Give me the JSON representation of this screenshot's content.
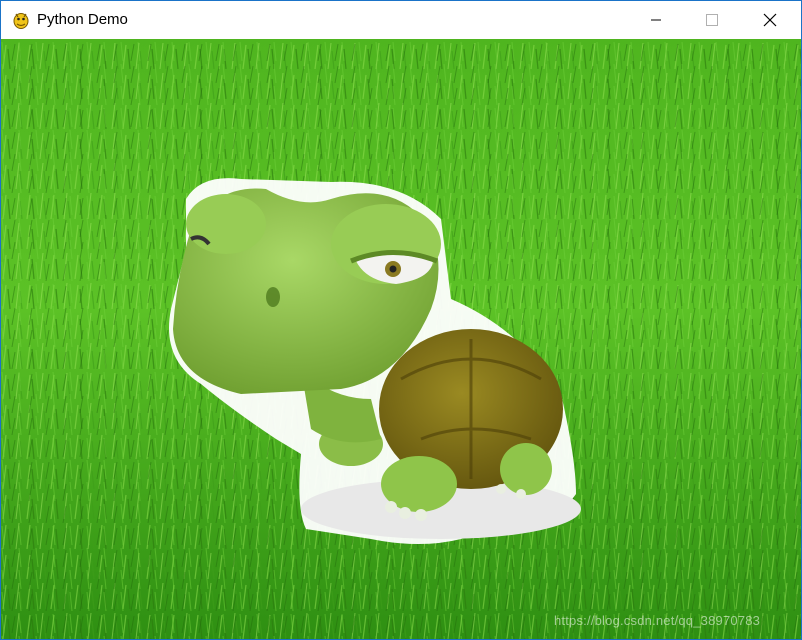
{
  "window": {
    "title": "Python Demo",
    "icon": "pygame-snake-icon",
    "controls": {
      "minimize_icon": "minimize-icon",
      "maximize_icon": "maximize-icon",
      "close_icon": "close-icon"
    }
  },
  "scene": {
    "background": "grass",
    "sprite": "cartoon-turtle",
    "colors": {
      "grass_dark": "#2f8f12",
      "grass_light": "#7ed640",
      "turtle_skin": "#8fc54a",
      "turtle_shell": "#7a6a12"
    }
  },
  "watermark": "https://blog.csdn.net/qq_38970783"
}
